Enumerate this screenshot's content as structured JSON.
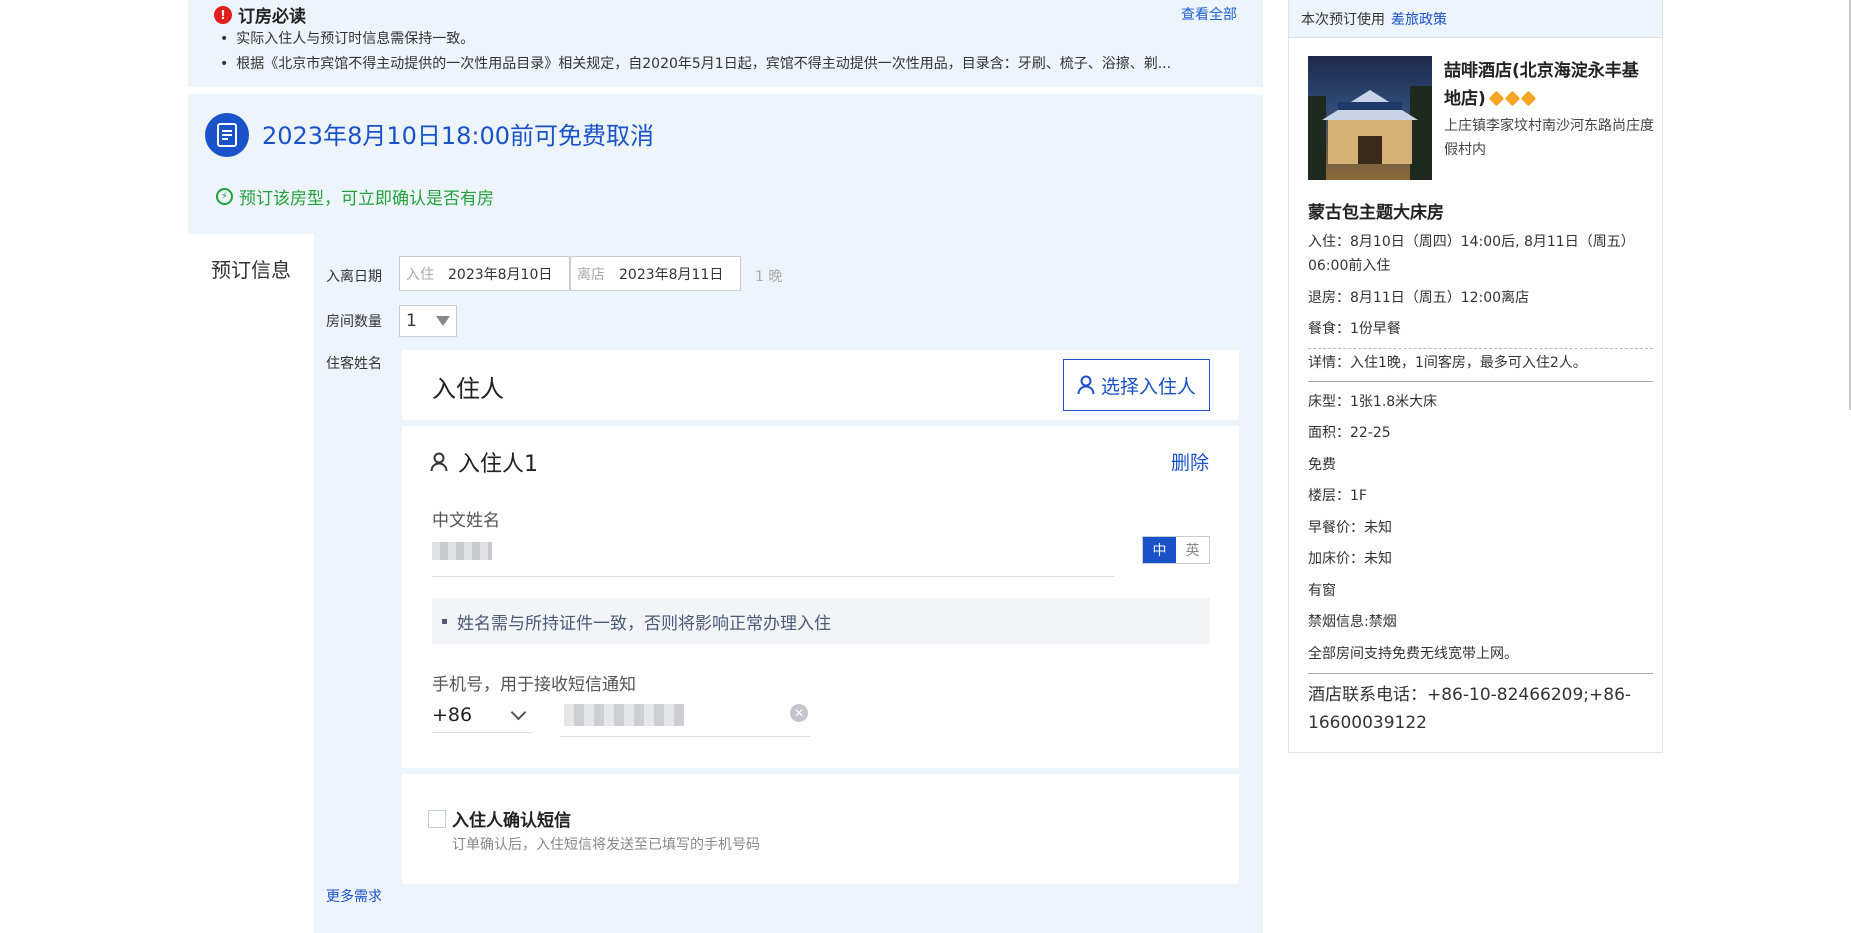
{
  "notice": {
    "title": "订房必读",
    "view_all": "查看全部",
    "items": [
      "实际入住人与预订时信息需保持一致。",
      "根据《北京市宾馆不得主动提供的一次性用品目录》相关规定，自2020年5月1日起，宾馆不得主动提供一次性用品，目录含：牙刷、梳子、浴擦、剃..."
    ]
  },
  "cancel": {
    "headline": "2023年8月10日18:00前可免费取消",
    "confirm_text": "预订该房型，可立即确认是否有房"
  },
  "booking": {
    "section_label": "预订信息",
    "dates_label": "入离日期",
    "checkin_placeholder": "入住",
    "checkin_value": "2023年8月10日",
    "checkout_placeholder": "离店",
    "checkout_value": "2023年8月11日",
    "nights": "1 晚",
    "rooms_label": "房间数量",
    "rooms_value": "1",
    "guest_name_label": "住客姓名"
  },
  "guest": {
    "header_title": "入住人",
    "select_button": "选择入住人",
    "guest_title": "入住人1",
    "delete_label": "删除",
    "cn_name_label": "中文姓名",
    "toggle_cn": "中",
    "toggle_en": "英",
    "tip": "姓名需与所持证件一致，否则将影响正常办理入住",
    "phone_label": "手机号，用于接收短信通知",
    "country_code": "+86"
  },
  "sms": {
    "title": "入住人确认短信",
    "subtitle": "订单确认后，入住短信将发送至已填写的手机号码"
  },
  "more_needs": "更多需求",
  "sidebar": {
    "policy_prefix": "本次预订使用",
    "policy_link": "差旅政策",
    "hotel_name": "喆啡酒店(北京海淀永丰基地店)",
    "hotel_address": "上庄镇李家坟村南沙河东路尚庄度假村内",
    "diamonds": 3,
    "room_name": "蒙古包主题大床房",
    "checkin_info": "入住：8月10日（周四）14:00后, 8月11日（周五）06:00前入住",
    "checkout_info": "退房：8月11日（周五）12:00离店",
    "meal": "餐食：1份早餐",
    "details": "详情：入住1晚，1间客房，最多可入住2人。",
    "bed": "床型：1张1.8米大床",
    "area": "面积：22-25",
    "free": "免费",
    "floor": "楼层：1F",
    "breakfast_price": "早餐价：未知",
    "extra_bed_price": "加床价：未知",
    "window": "有窗",
    "smoking": "禁烟信息:禁烟",
    "wifi": "全部房间支持免费无线宽带上网。",
    "contact": "酒店联系电话：+86-10-82466209;+86-16600039122"
  },
  "colors": {
    "accent": "#1a52c9",
    "success": "#21a23c",
    "alert": "#e21f1f",
    "panel_bg": "#eef4fb",
    "diamond": "#f5a623"
  }
}
